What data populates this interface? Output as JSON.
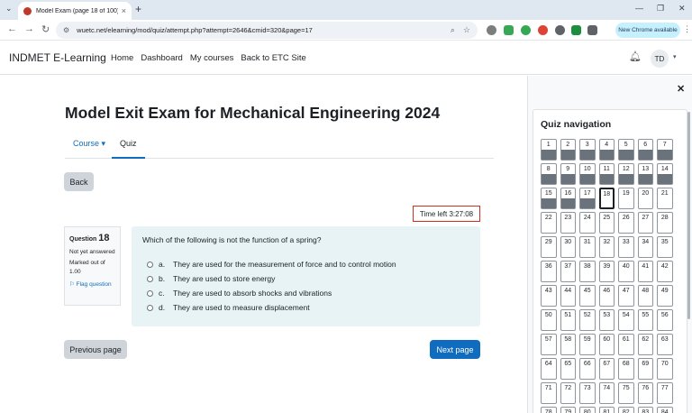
{
  "browser": {
    "tab_title": "Model Exam (page 18 of 100) :",
    "tab_close": "×",
    "new_tab": "+",
    "url": "wuetc.net/elearning/mod/quiz/attempt.php?attempt=2646&cmid=320&page=17",
    "new_chrome_label": "New Chrome available",
    "icons": {
      "back": "←",
      "forward": "→",
      "reload": "↻",
      "tune": "⚙",
      "zoom": "⌕",
      "star": "☆",
      "minimize": "—",
      "restore": "❐",
      "close": "✕",
      "menu": "⋮",
      "tab_search": "⌄"
    }
  },
  "site": {
    "brand": "INDMET E-Learning",
    "menu": [
      "Home",
      "Dashboard",
      "My courses",
      "Back to ETC Site"
    ],
    "avatar_initials": "TD",
    "bell_icon": "🔔",
    "caret": "▾"
  },
  "page": {
    "title": "Model Exit Exam for Mechanical Engineering 2024",
    "tabs": {
      "course": "Course",
      "course_caret": "▾",
      "quiz": "Quiz"
    },
    "back_label": "Back",
    "timer": "Time left 3:27:08"
  },
  "question": {
    "label": "Question",
    "number": "18",
    "state": "Not yet answered",
    "marks": "Marked out of 1.00",
    "flag_label": "Flag question",
    "flag_icon": "⚐",
    "text": "Which of the following is not the function of a spring?",
    "options": [
      {
        "letter": "a.",
        "text": "They are used for the measurement of force and to control motion"
      },
      {
        "letter": "b.",
        "text": "They are used to store energy"
      },
      {
        "letter": "c.",
        "text": "They are used to absorb shocks and vibrations"
      },
      {
        "letter": "d.",
        "text": "They are used to measure displacement"
      }
    ]
  },
  "footer": {
    "prev_label": "Previous page",
    "next_label": "Next page"
  },
  "quiz_nav": {
    "title": "Quiz navigation",
    "close_icon": "✕",
    "answered_through": 17,
    "current": 18,
    "cells": [
      1,
      2,
      3,
      4,
      5,
      6,
      7,
      8,
      9,
      10,
      11,
      12,
      13,
      14,
      15,
      16,
      17,
      18,
      19,
      20,
      21,
      22,
      23,
      24,
      25,
      26,
      27,
      28,
      29,
      30,
      31,
      32,
      33,
      34,
      35,
      36,
      37,
      38,
      39,
      40,
      41,
      42,
      43,
      44,
      45,
      46,
      47,
      48,
      49,
      50,
      51,
      52,
      53,
      54,
      55,
      56,
      57,
      58,
      59,
      60,
      61,
      62,
      63,
      64,
      65,
      66,
      67,
      68,
      69,
      70,
      71,
      72,
      73,
      74,
      75,
      76,
      77,
      78,
      79,
      80,
      81,
      82,
      83,
      84
    ]
  },
  "colors": {
    "primary": "#0f6cbf",
    "answered": "#6a737b",
    "timer_border": "#ca3120",
    "question_bg": "#e7f3f5"
  }
}
